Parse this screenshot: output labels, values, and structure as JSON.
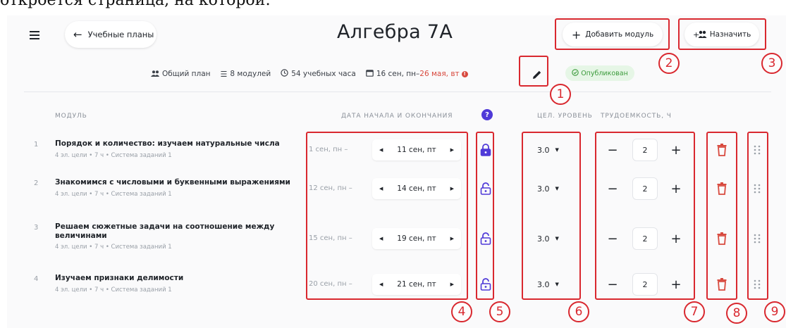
{
  "document_text": "откроется страница, на которой:",
  "header": {
    "back_label": "Учебные планы",
    "title": "Алгебра 7А",
    "add_module_label": "Добавить модуль",
    "assign_label": "Назначить"
  },
  "meta": {
    "plan_type": "Общий план",
    "modules_count": "8 модулей",
    "hours": "54 учебных часа",
    "date_start": "16 сен, пн–",
    "date_end": "26 мая, вт",
    "status": "Опубликован"
  },
  "table": {
    "col_module": "МОДУЛЬ",
    "col_dates": "ДАТА НАЧАЛА И ОКОНЧАНИЯ",
    "col_level": "ЦЕЛ. УРОВЕНЬ",
    "col_effort": "ТРУДОЕМКОСТЬ, Ч",
    "help_glyph": "?",
    "rows": [
      {
        "num": "1",
        "title": "Порядок и количество: изучаем натуральные числа",
        "meta": "4 эл. цели • 7 ч • Система заданий 1",
        "start": "1 сен, пн –",
        "end": "11 сен, пт",
        "locked": true,
        "level": "3.0",
        "effort": "2"
      },
      {
        "num": "2",
        "title": "Знакомимся с числовыми и буквенными выражениями",
        "meta": "4 эл. цели • 7 ч • Система заданий 1",
        "start": "12 сен, пн –",
        "end": "14 сен, пт",
        "locked": false,
        "level": "3.0",
        "effort": "2"
      },
      {
        "num": "3",
        "title": "Решаем сюжетные задачи на соотношение между величинами",
        "meta": "4 эл. цели • 7 ч • Система заданий 1",
        "start": "15 сен, пн –",
        "end": "19 сен, пт",
        "locked": false,
        "level": "3.0",
        "effort": "2"
      },
      {
        "num": "4",
        "title": "Изучаем признаки делимости",
        "meta": "4 эл. цели • 7 ч • Система заданий 1",
        "start": "20 сен, пн –",
        "end": "21 сен, пт",
        "locked": false,
        "level": "3.0",
        "effort": "2"
      }
    ]
  },
  "annotations": [
    "1",
    "2",
    "3",
    "4",
    "5",
    "6",
    "7",
    "8",
    "9"
  ],
  "colors": {
    "accent": "#4f3ad8",
    "annotation": "#d9282f",
    "published_bg": "#e6f6e6",
    "published_text": "#3a9a3a",
    "warning": "#d84a3f"
  }
}
